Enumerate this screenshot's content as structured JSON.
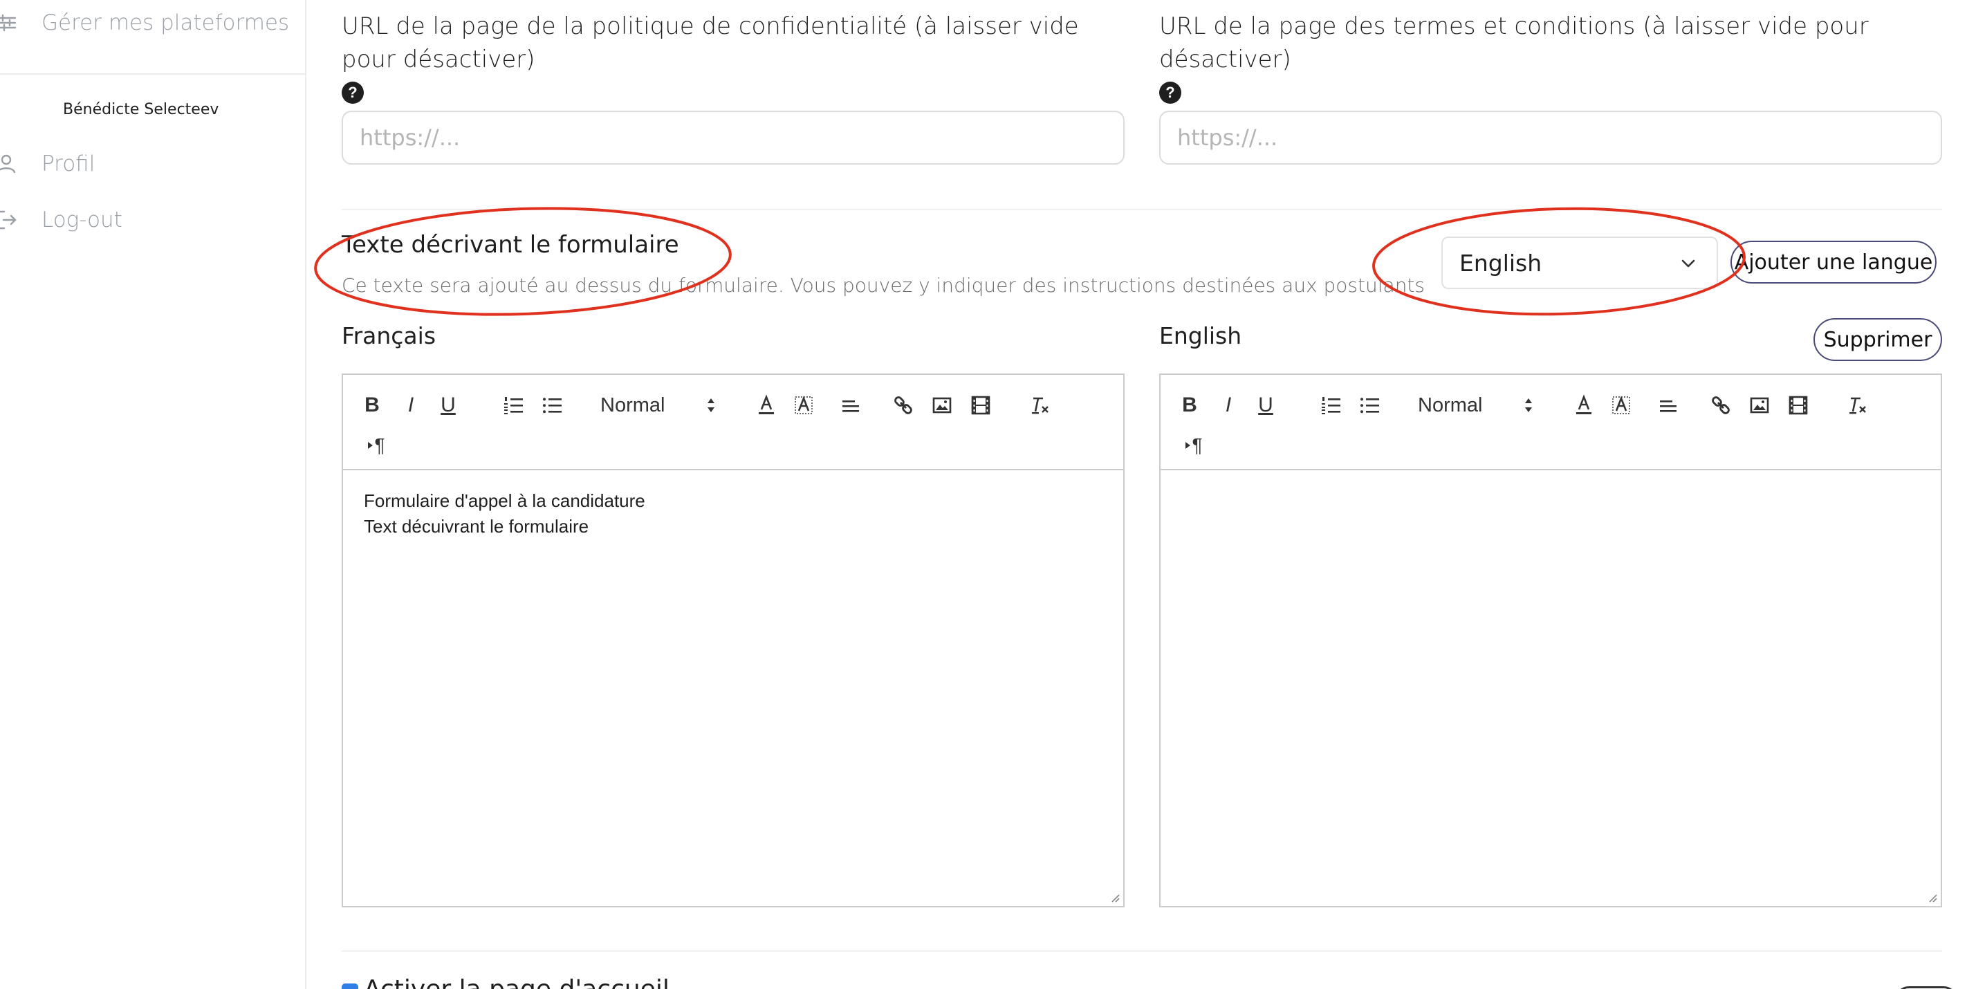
{
  "sidebar": {
    "items": [
      {
        "label": "Gérer mes plateformes",
        "icon": "sliders-icon"
      },
      {
        "label": "Profil",
        "icon": "user-icon"
      },
      {
        "label": "Log-out",
        "icon": "logout-icon"
      }
    ],
    "user_name": "Bénédicte Selecteev"
  },
  "privacy": {
    "label": "URL de la page de la politique de confidentialité (à laisser vide pour désactiver)",
    "help": "?",
    "placeholder": "https://..."
  },
  "terms": {
    "label": "URL de la page des termes et conditions (à laisser vide pour désactiver)",
    "help": "?",
    "placeholder": "https://..."
  },
  "description_section": {
    "title": "Texte décrivant le formulaire",
    "subtitle": "Ce texte sera ajouté au dessus du formulaire. Vous pouvez y indiquer des instructions destinées aux postulants",
    "language_select": {
      "selected": "English"
    },
    "add_language_button": "Ajouter une langue"
  },
  "editors": [
    {
      "language": "Français",
      "heading_select": "Normal",
      "content_lines": [
        "Formulaire d'appel à la candidature",
        "Text décuivrant le formulaire"
      ]
    },
    {
      "language": "English",
      "delete_button": "Supprimer",
      "heading_select": "Normal",
      "content_lines": []
    }
  ],
  "toolbar": {
    "bold": "B",
    "italic": "I",
    "underline": "U",
    "pilcrow": "¶"
  },
  "homepage": {
    "label": "Activer la page d'accueil",
    "checked": true
  },
  "colors": {
    "annotation": "#e0301e",
    "checkbox": "#2f7fe6",
    "button_border": "#4a4a7a"
  }
}
